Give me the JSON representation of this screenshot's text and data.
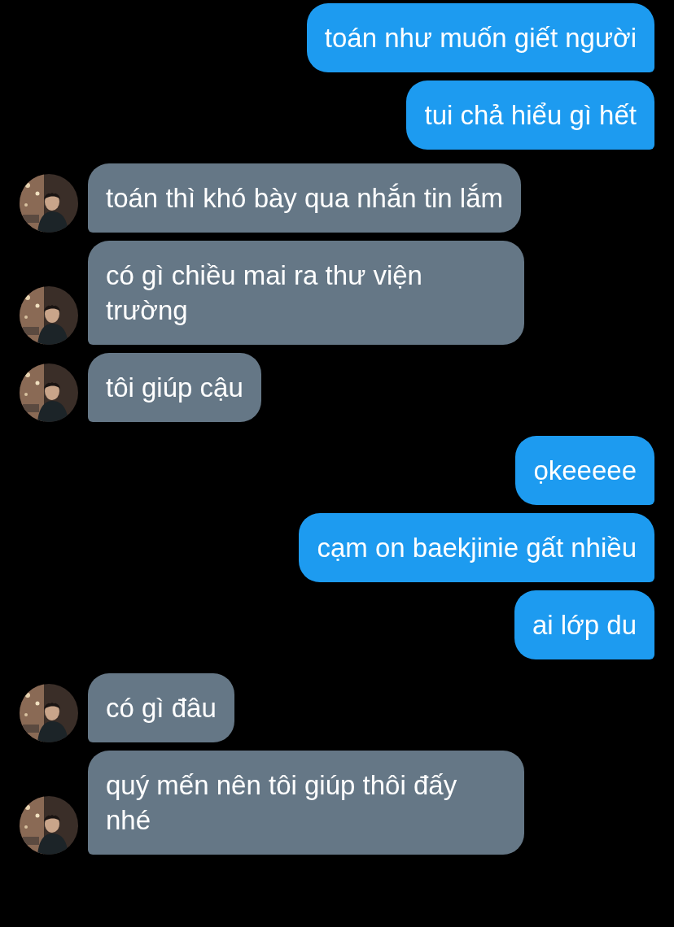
{
  "messages": [
    {
      "kind": "sent",
      "text": "toán như muốn giết người"
    },
    {
      "kind": "sent",
      "text": "tui chả hiểu gì hết"
    },
    {
      "kind": "received",
      "text": "toán thì khó bày qua nhắn tin lắm"
    },
    {
      "kind": "received",
      "text": "có gì chiều mai ra thư viện trường"
    },
    {
      "kind": "received",
      "text": "tôi giúp cậu"
    },
    {
      "kind": "sent",
      "text": "ọkeeeee"
    },
    {
      "kind": "sent",
      "text": "cạm on baekjinie gất nhiều"
    },
    {
      "kind": "sent",
      "text": "ai lớp du"
    },
    {
      "kind": "received",
      "text": "có gì đâu"
    },
    {
      "kind": "received",
      "text": "quý mến nên tôi giúp thôi đấy nhé"
    }
  ]
}
